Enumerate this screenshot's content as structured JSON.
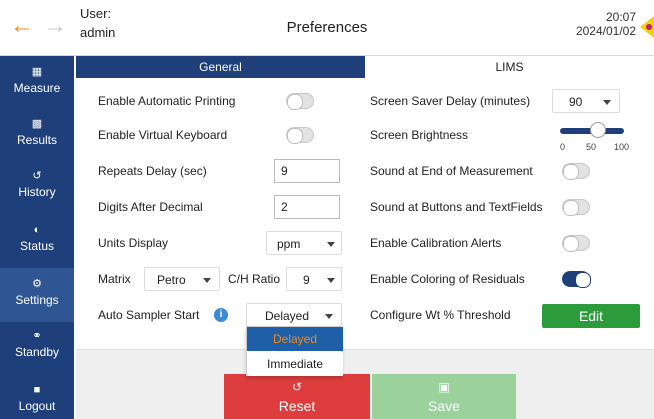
{
  "header": {
    "user_label": "User:",
    "user_name": "admin",
    "title": "Preferences",
    "time": "20:07",
    "date": "2024/01/02"
  },
  "sidebar": {
    "items": [
      {
        "label": "Measure",
        "icon": "measure-icon",
        "active": false
      },
      {
        "label": "Results",
        "icon": "bar-chart-icon",
        "active": false
      },
      {
        "label": "History",
        "icon": "history-icon",
        "active": false
      },
      {
        "label": "Status",
        "icon": "gauge-icon",
        "active": false
      },
      {
        "label": "Settings",
        "icon": "gear-icon",
        "active": true
      },
      {
        "label": "Standby",
        "icon": "power-icon",
        "active": false
      },
      {
        "label": "Logout",
        "icon": "lock-icon",
        "active": false
      }
    ]
  },
  "tabs": {
    "general": "General",
    "lims": "LIMS"
  },
  "left": {
    "auto_print": {
      "label": "Enable Automatic Printing",
      "on": false
    },
    "virtual_kbd": {
      "label": "Enable Virtual Keyboard",
      "on": false
    },
    "repeats_delay": {
      "label": "Repeats Delay (sec)",
      "value": "9"
    },
    "digits_decimal": {
      "label": "Digits After Decimal",
      "value": "2"
    },
    "units": {
      "label": "Units Display",
      "value": "ppm"
    },
    "matrix": {
      "label": "Matrix",
      "value": "Petro"
    },
    "ch_ratio": {
      "label": "C/H Ratio",
      "value": "9"
    },
    "auto_sampler": {
      "label": "Auto Sampler Start",
      "value": "Delayed",
      "options": [
        "Delayed",
        "Immediate"
      ]
    }
  },
  "right": {
    "screen_saver": {
      "label": "Screen Saver Delay (minutes)",
      "value": "90"
    },
    "brightness": {
      "label": "Screen Brightness",
      "value": 50,
      "ticks": [
        "0",
        "50",
        "100"
      ]
    },
    "sound_end": {
      "label": "Sound at End of Measurement",
      "on": false
    },
    "sound_buttons": {
      "label": "Sound at Buttons and TextFields",
      "on": false
    },
    "calib_alerts": {
      "label": "Enable Calibration Alerts",
      "on": false
    },
    "coloring_residuals": {
      "label": "Enable Coloring of Residuals",
      "on": true
    },
    "wt_threshold": {
      "label": "Configure Wt % Threshold",
      "button": "Edit"
    }
  },
  "actions": {
    "reset": "Reset",
    "save": "Save"
  },
  "colors": {
    "sidebar_bg": "#1e3f7a",
    "accent_orange": "#f08a1c",
    "reset_red": "#dd3d3d",
    "save_green": "#9bd19b",
    "edit_green": "#2c9b3b"
  }
}
